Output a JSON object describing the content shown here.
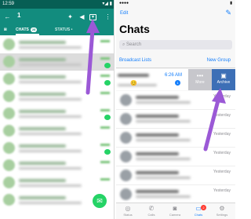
{
  "left": {
    "status_time": "12:59",
    "status_right": "▾◢ ▮",
    "selected_count": "1",
    "tabs": {
      "chats_label": "CHATS",
      "chats_badge": "28",
      "status_label": "STATUS •"
    },
    "icons": [
      "back-arrow-icon",
      "pin-icon",
      "mute-icon",
      "archive-icon",
      "overflow-menu-icon",
      "camera-icon",
      "new-chat-icon"
    ]
  },
  "right": {
    "status_left": "●●●●",
    "status_right": "▮",
    "edit_label": "Edit",
    "title": "Chats",
    "search_placeholder": "Search",
    "broadcast_label": "Broadcast Lists",
    "new_group_label": "New Group",
    "first_row": {
      "time": "6:26 AM",
      "unread": "1"
    },
    "actions": {
      "more_label": "More",
      "archive_label": "Archive"
    },
    "row_times": [
      "Yesterday",
      "Yesterday",
      "Yesterday",
      "Yesterday",
      "Yesterday",
      "Yesterday"
    ],
    "tabbar": [
      {
        "label": "Status"
      },
      {
        "label": "Calls"
      },
      {
        "label": "Camera"
      },
      {
        "label": "Chats",
        "badge": "2"
      },
      {
        "label": "Settings"
      }
    ]
  },
  "colors": {
    "whatsapp_teal": "#128c7e",
    "whatsapp_green": "#25d366",
    "ios_blue": "#147efb",
    "archive_blue": "#3d6fb6",
    "arrow_purple": "#9b59d6"
  }
}
